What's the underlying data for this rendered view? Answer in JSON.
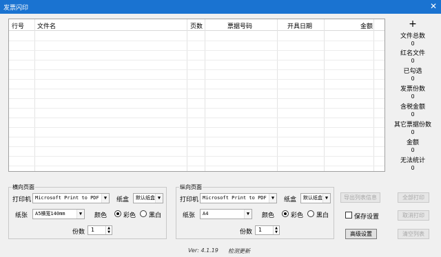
{
  "window": {
    "title": "发票闪印",
    "close_glyph": "✕"
  },
  "grid": {
    "columns": [
      "行号",
      "文件名",
      "页数",
      "票据号码",
      "开具日期",
      "金额"
    ]
  },
  "stats": {
    "plus": "+",
    "items": [
      {
        "label": "文件总数",
        "value": "0"
      },
      {
        "label": "红名文件",
        "value": "0"
      },
      {
        "label": "已勾选",
        "value": "0"
      },
      {
        "label": "发票份数",
        "value": "0"
      },
      {
        "label": "含税金额",
        "value": "0"
      },
      {
        "label": "其它票据份数",
        "value": "0"
      },
      {
        "label": "金额",
        "value": "0"
      },
      {
        "label": "无法统计",
        "value": "0"
      }
    ]
  },
  "landscape": {
    "title": "横向页面",
    "printer_label": "打印机",
    "printer_value": "Microsoft Print to PDF",
    "tray_label": "纸盒",
    "tray_value": "默认纸盒",
    "paper_label": "纸张",
    "paper_value": "A5横宽140mm",
    "color_label": "颜色",
    "color_option": "彩色",
    "bw_option": "黑白",
    "copies_label": "份数",
    "copies_value": "1"
  },
  "portrait": {
    "title": "纵向页面",
    "printer_label": "打印机",
    "printer_value": "Microsoft Print to PDF",
    "tray_label": "纸盒",
    "tray_value": "默认纸盒",
    "paper_label": "纸张",
    "paper_value": "A4",
    "color_label": "颜色",
    "color_option": "彩色",
    "bw_option": "黑白",
    "copies_label": "份数",
    "copies_value": "1"
  },
  "actions": {
    "export_list": "导出列表信息",
    "save_settings": "保存设置",
    "advanced": "高级设置",
    "print_all": "全部打印",
    "cancel_print": "取消打印",
    "clear_list": "清空列表"
  },
  "footer": {
    "version": "Ver: 4.1.19",
    "check_update": "检测更新"
  }
}
